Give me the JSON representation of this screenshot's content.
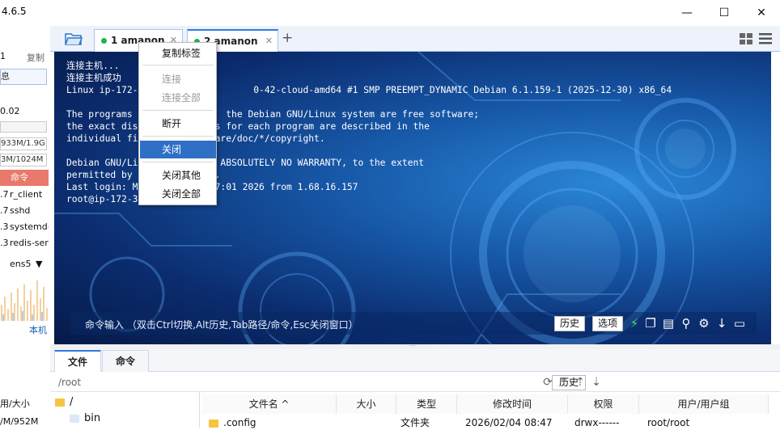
{
  "app": {
    "version": "4.6.5"
  },
  "window_controls": {
    "minimize": "—",
    "maximize": "☐",
    "close": "✕"
  },
  "left_panel": {
    "lines": [
      "1",
      "复制",
      "息",
      "0.02",
      "933M/1.9G",
      "3M/1024M"
    ],
    "process_header": "命令",
    "processes": [
      {
        "cpu": ".7",
        "name": "r_client"
      },
      {
        "cpu": ".7",
        "name": "sshd"
      },
      {
        "cpu": ".3",
        "name": "systemd-"
      },
      {
        "cpu": ".3",
        "name": "redis-ser"
      }
    ],
    "net_interface": "ens5",
    "local_label": "本机",
    "bottom_lines": [
      "用/大小",
      "/M/952M"
    ]
  },
  "tabs": [
    {
      "label": "1 amanon",
      "status_color": "#21b24b"
    },
    {
      "label": "2 amanon",
      "status_color": "#21b24b"
    }
  ],
  "context_menu": {
    "items": [
      {
        "label": "复制标签",
        "state": "enabled"
      },
      {
        "label": "连接",
        "state": "disabled"
      },
      {
        "label": "连接全部",
        "state": "disabled"
      },
      {
        "label": "断开",
        "state": "enabled"
      },
      {
        "label": "关闭",
        "state": "highlighted"
      },
      {
        "label": "关闭其他",
        "state": "enabled"
      },
      {
        "label": "关闭全部",
        "state": "enabled"
      }
    ]
  },
  "terminal": {
    "lines": [
      "连接主机...",
      "连接主机成功",
      "Linux ip-172-                     0-42-cloud-amd64 #1 SMP PREEMPT_DYNAMIC Debian 6.1.159-1 (2025-12-30) x86_64",
      "",
      "The programs                 the Debian GNU/Linux system are free software;",
      "the exact dis             ns for each program are described in the",
      "individual fi             hare/doc/*/copyright.",
      "",
      "Debian GNU/Li             h ABSOLUTELY NO WARRANTY, to the extent",
      "permitted by              y.",
      "Last login: M             07:01 2026 from 1.68.16.157",
      "root@ip-172-3"
    ],
    "command_hint": "命令输入 （双击Ctrl切换,Alt历史,Tab路径/命令,Esc关闭窗口）",
    "history_button": "历史",
    "options_button": "选项"
  },
  "lower_tabs": [
    "文件",
    "命令"
  ],
  "file_panel": {
    "path": "/root",
    "history_button": "历史",
    "tree": [
      "/",
      "bin"
    ],
    "columns": [
      "文件名 ^",
      "大小",
      "类型",
      "修改时间",
      "权限",
      "用户/用户组"
    ],
    "rows": [
      {
        "name": ".config",
        "size": "",
        "type": "文件夹",
        "modified": "2026/02/04 08:47",
        "perm": "drwx------",
        "owner": "root/root"
      }
    ]
  },
  "colors": {
    "accent": "#2f6fc5",
    "status_green": "#21b24b",
    "terminal_bg": "#0b2c6e"
  }
}
